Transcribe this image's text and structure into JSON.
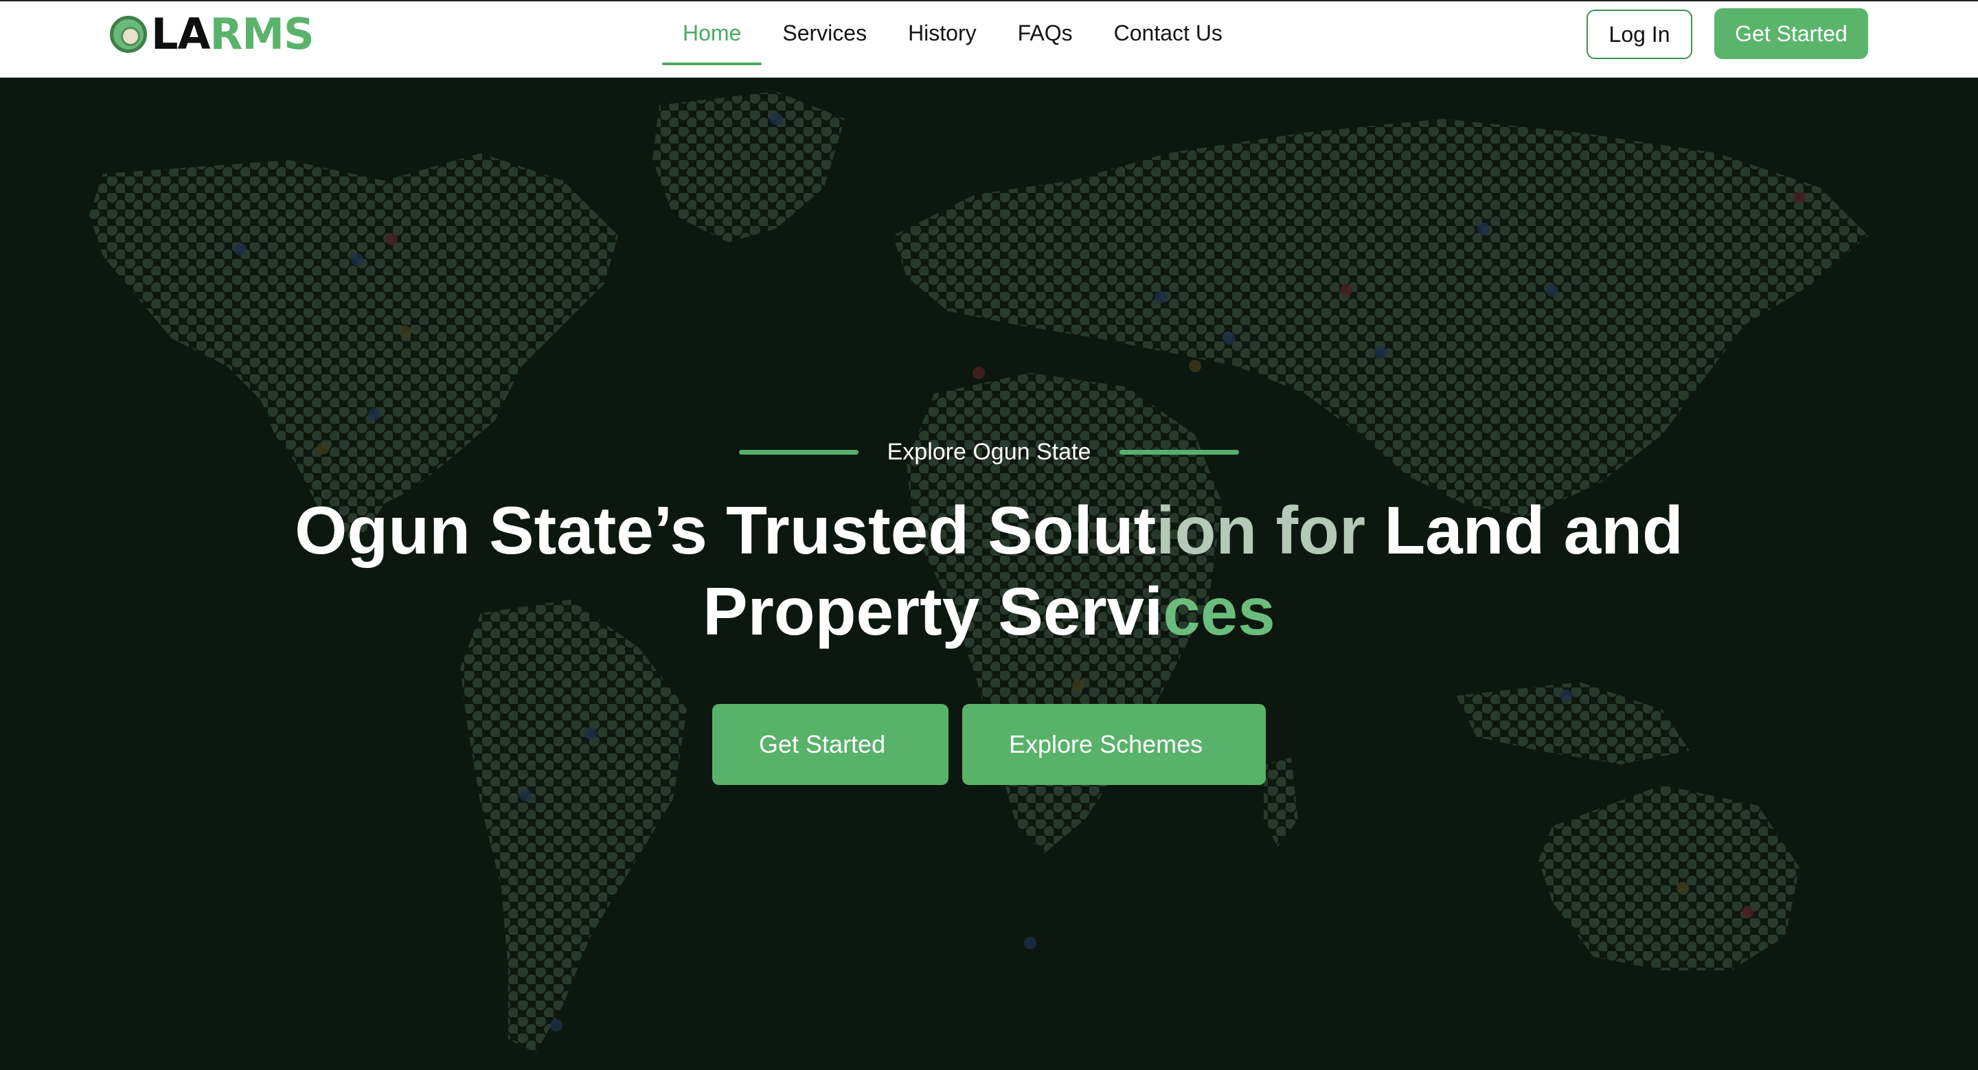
{
  "brand": {
    "logo_text_dark": "LA",
    "logo_text_green": "RMS",
    "seal_icon": "ogun-state-seal-icon",
    "green": "#5bb46c",
    "dark_bg": "#0c170f"
  },
  "nav": {
    "items": [
      {
        "label": "Home",
        "active": true
      },
      {
        "label": "Services",
        "active": false
      },
      {
        "label": "History",
        "active": false
      },
      {
        "label": "FAQs",
        "active": false
      },
      {
        "label": "Contact Us",
        "active": false
      }
    ],
    "login_label": "Log In",
    "get_started_label": "Get Started"
  },
  "hero": {
    "kicker": "Explore Ogun State",
    "headline": {
      "part1": "Ogun State’s Trusted Solut",
      "part2": "ion for",
      "part3": " Land and",
      "part4": "Property Servi",
      "part5": "ces"
    },
    "background": "world-map-hexagon-pattern",
    "get_started_label": "Get Started",
    "explore_label": "Explore Schemes"
  }
}
